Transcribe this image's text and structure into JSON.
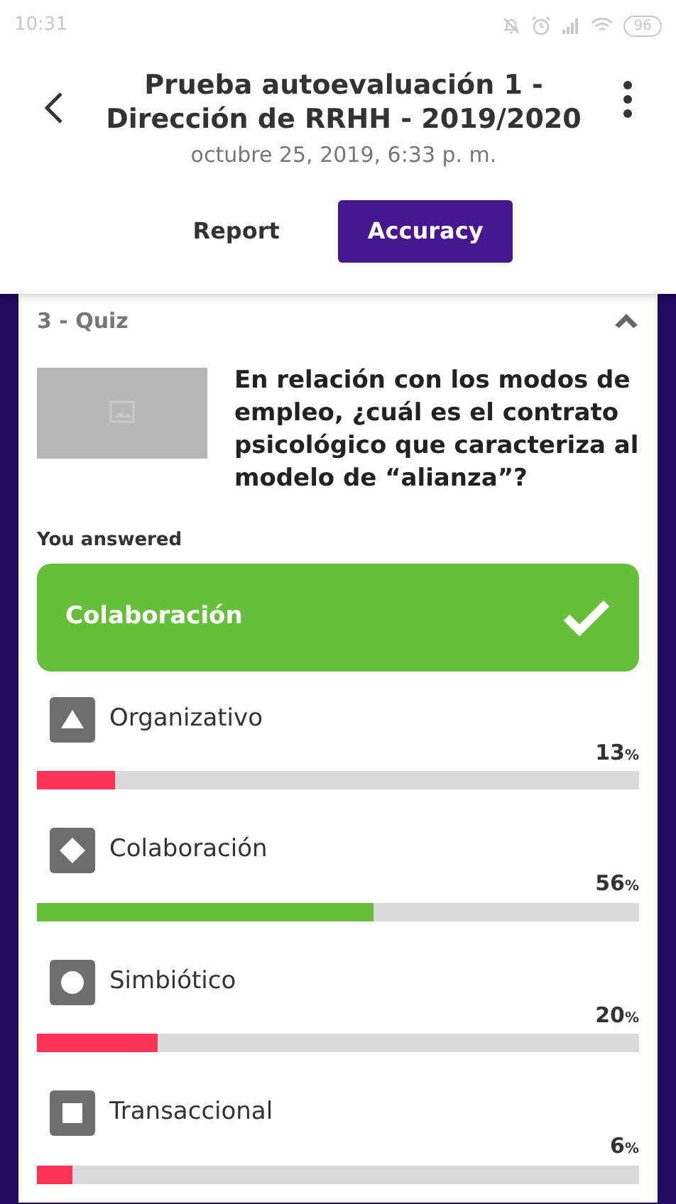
{
  "status_bar": {
    "time": "10:31",
    "battery": "96"
  },
  "header": {
    "title": "Prueba autoevaluación 1 - Dirección de RRHH - 2019/2020",
    "date": "octubre 25, 2019, 6:33 p. m."
  },
  "tabs": [
    {
      "label": "Report",
      "selected": false
    },
    {
      "label": "Accuracy",
      "selected": true
    }
  ],
  "question": {
    "heading": "3 - Quiz",
    "expanded": true,
    "text": "En relación con los modos de empleo, ¿cuál es el contrato psicológico que caracteriza al modelo de “alianza”?",
    "answer_label": "You answered",
    "answer": {
      "text": "Colaboración",
      "correct": true
    }
  },
  "options": [
    {
      "kind": "triangle",
      "label": "Organizativo",
      "value": "13",
      "unit": "%",
      "correct": false,
      "level": 0.13
    },
    {
      "kind": "diamond",
      "label": "Colaboración",
      "value": "56",
      "unit": "%",
      "correct": true,
      "level": 0.56
    },
    {
      "kind": "circle",
      "label": "Simbiótico",
      "value": "20",
      "unit": "%",
      "correct": false,
      "level": 0.2
    },
    {
      "kind": "square",
      "label": "Transaccional",
      "value": "6",
      "unit": "%",
      "correct": false,
      "level": 0.06
    }
  ]
}
